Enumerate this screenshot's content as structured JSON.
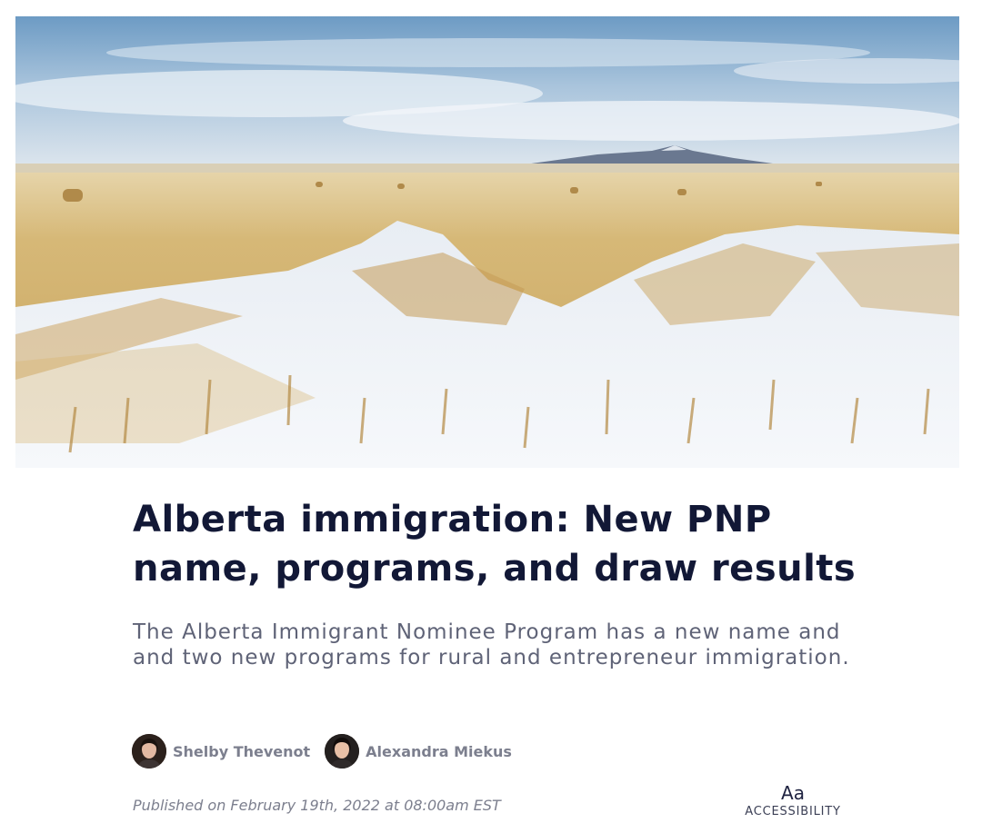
{
  "hero": {
    "image": "snowy-prairie-field-with-hay-bales"
  },
  "article": {
    "title": "Alberta immigration: New PNP name, programs, and draw results",
    "subtitle": "The Alberta Immigrant Nominee Program has a new name and and two new programs for rural and entrepreneur immigration.",
    "authors": [
      {
        "name": "Shelby Thevenot",
        "avatar": "author-avatar-icon"
      },
      {
        "name": "Alexandra Miekus",
        "avatar": "author-avatar-icon"
      }
    ],
    "published": "Published on February 19th, 2022 at 08:00am EST"
  },
  "accessibility": {
    "icon_text": "Aa",
    "label": "ACCESSIBILITY",
    "icon": "text-size-icon"
  },
  "colors": {
    "title": "#121836",
    "subtitle": "#5f6377",
    "meta": "#7c7f8e"
  }
}
